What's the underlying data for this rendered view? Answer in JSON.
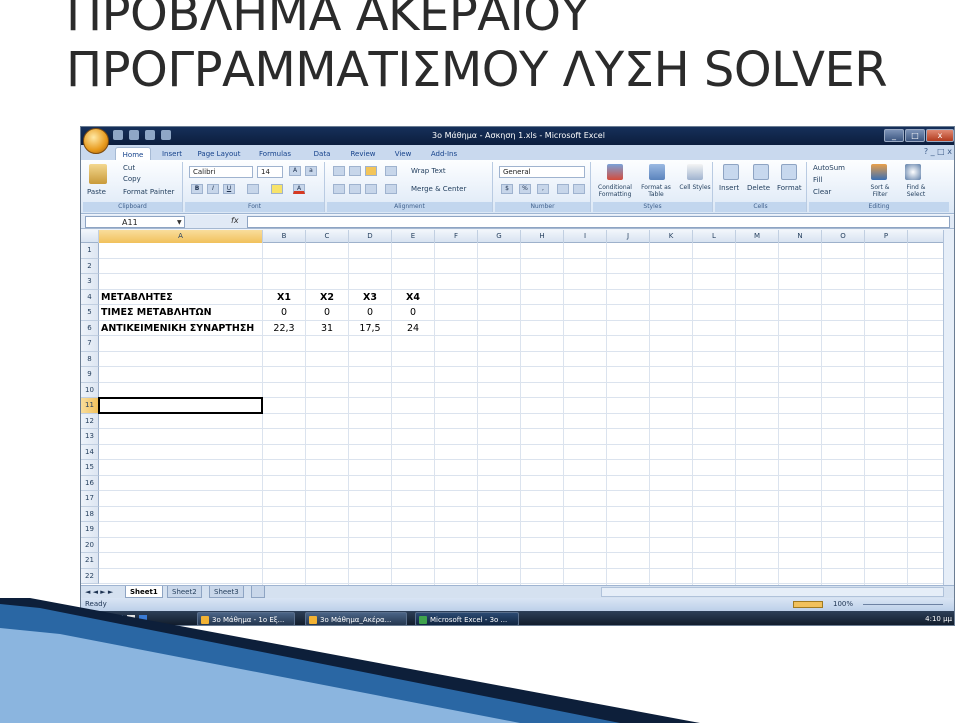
{
  "slide": {
    "title_line1": "ΠΡΟΒΛΗΜΑ ΑΚΕΡΑΙΟΥ",
    "title_line2": "ΠΡΟΓΡΑΜΜΑΤΙΣΜΟΥ ΛΥΣΗ SOLVER"
  },
  "window": {
    "title": "3ο Μάθημα - Ασκηση 1.xls - Microsoft Excel",
    "controls": [
      "_",
      "□",
      "x"
    ]
  },
  "ribbon": {
    "tabs": [
      "Home",
      "Insert",
      "Page Layout",
      "Formulas",
      "Data",
      "Review",
      "View",
      "Add-Ins"
    ],
    "active_tab": "Home",
    "clipboard": {
      "paste": "Paste",
      "cut": "Cut",
      "copy": "Copy",
      "format_painter": "Format Painter",
      "label": "Clipboard"
    },
    "font": {
      "name": "Calibri",
      "size": "14",
      "bold": "B",
      "italic": "I",
      "underline": "U",
      "label": "Font"
    },
    "alignment": {
      "wrap": "Wrap Text",
      "merge": "Merge & Center",
      "label": "Alignment"
    },
    "number": {
      "format": "General",
      "label": "Number"
    },
    "styles": {
      "conditional": "Conditional Formatting",
      "format_table": "Format as Table",
      "cell_styles": "Cell Styles",
      "label": "Styles"
    },
    "cells": {
      "insert": "Insert",
      "delete": "Delete",
      "format": "Format",
      "label": "Cells"
    },
    "editing": {
      "autosum": "AutoSum",
      "fill": "Fill",
      "clear": "Clear",
      "sort": "Sort & Filter",
      "find": "Find & Select",
      "label": "Editing"
    }
  },
  "formula_bar": {
    "name_box": "A11",
    "fx": "fx",
    "value": ""
  },
  "sheet": {
    "columns": [
      "A",
      "B",
      "C",
      "D",
      "E",
      "F",
      "G",
      "H",
      "I",
      "J",
      "K",
      "L",
      "M",
      "N",
      "O",
      "P"
    ],
    "rows": [
      "1",
      "2",
      "3",
      "4",
      "5",
      "6",
      "7",
      "8",
      "9",
      "10",
      "11",
      "12",
      "13",
      "14",
      "15",
      "16",
      "17",
      "18",
      "19",
      "20",
      "21",
      "22"
    ],
    "selected_cell": "A11",
    "cells": {
      "A4": "ΜΕΤΑΒΛΗΤΕΣ",
      "A5": "ΤΙΜΕΣ ΜΕΤΑΒΛΗΤΩΝ",
      "A6": "ΑΝΤΙΚΕΙΜΕΝΙΚΗ ΣΥΝΑΡΤΗΣΗ",
      "B4": "X1",
      "C4": "X2",
      "D4": "X3",
      "E4": "X4",
      "B5": "0",
      "C5": "0",
      "D5": "0",
      "E5": "0",
      "B6": "22,3",
      "C6": "31",
      "D6": "17,5",
      "E6": "24"
    }
  },
  "sheet_tabs": [
    "Sheet1",
    "Sheet2",
    "Sheet3"
  ],
  "active_sheet": "Sheet1",
  "status": {
    "ready": "Ready",
    "zoom": "100%"
  },
  "taskbar": {
    "items": [
      "3ο Μάθημα - 1ο Εξ...",
      "3ο Μάθημα_Ακέρα...",
      "Microsoft Excel - 3ο ..."
    ],
    "clock": "4:10 μμ"
  },
  "colors": {
    "title_text": "#2b2b2b",
    "ribbon_blue": "#c9d9ee",
    "selection": "#000000",
    "swoosh": "#0d1f3a"
  }
}
